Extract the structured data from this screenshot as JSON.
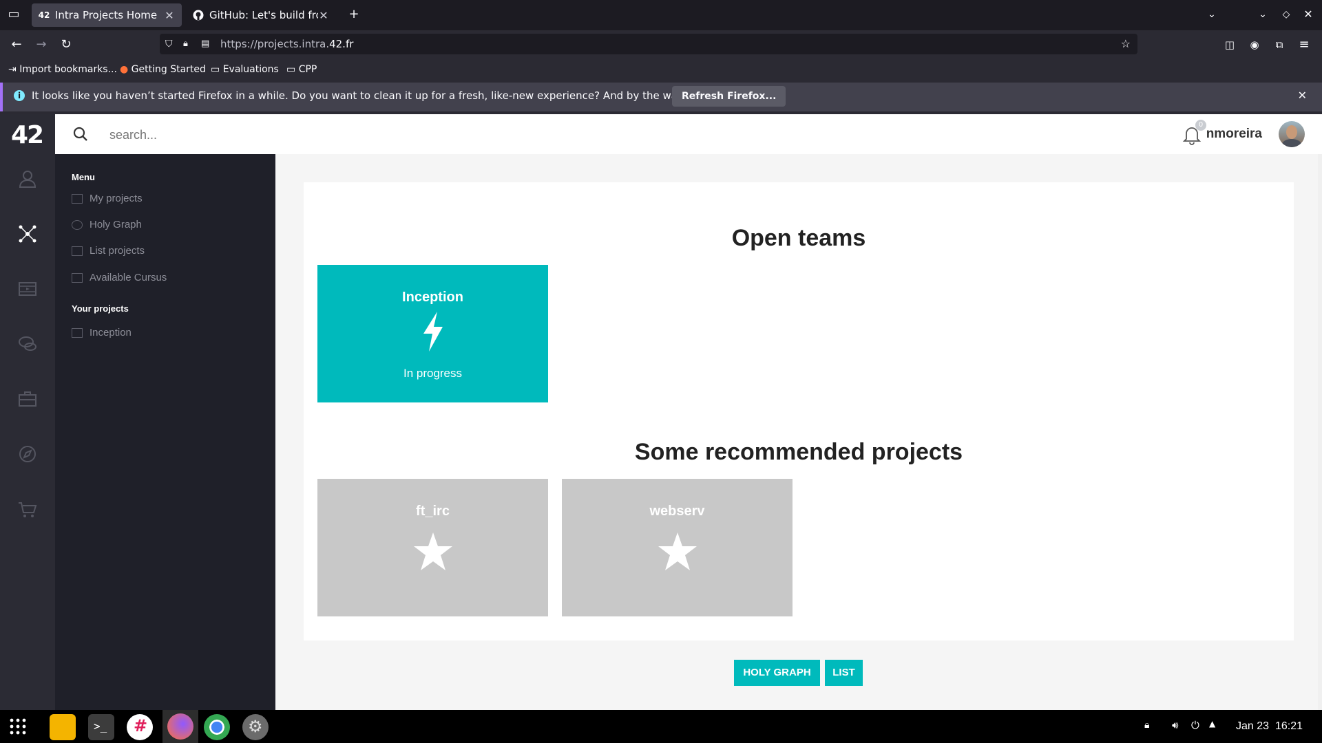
{
  "browser": {
    "tabs": [
      {
        "title": "Intra Projects Home",
        "active": true
      },
      {
        "title": "GitHub: Let's build from h",
        "active": false
      }
    ],
    "url_prefix": "https://projects.intra.",
    "url_domain": "42.fr",
    "bookmarks": [
      "Import bookmarks...",
      "Getting Started",
      "Evaluations",
      "CPP"
    ],
    "notice": "It looks like you haven’t started Firefox in a while. Do you want to clean it up for a fresh, like-new experience? And by the way, welcome back!",
    "notice_button": "Refresh Firefox..."
  },
  "app": {
    "logo": "42",
    "search_placeholder": "search...",
    "notifications_count": "0",
    "username": "nmoreira",
    "menu": {
      "heading": "Menu",
      "items": [
        "My projects",
        "Holy Graph",
        "List projects",
        "Available Cursus"
      ],
      "your_projects_heading": "Your projects",
      "your_projects": [
        "Inception"
      ]
    },
    "open_teams_title": "Open teams",
    "open_teams": [
      {
        "name": "Inception",
        "status": "In progress",
        "icon": "lightning-icon",
        "color": "#00babc"
      }
    ],
    "recommended_title": "Some recommended projects",
    "recommended": [
      {
        "name": "ft_irc",
        "icon": "star-icon",
        "color": "#c8c8c8"
      },
      {
        "name": "webserv",
        "icon": "star-icon",
        "color": "#c8c8c8"
      }
    ],
    "buttons": {
      "holy_graph": "HOLY GRAPH",
      "list": "LIST"
    }
  },
  "system": {
    "date": "Jan 23",
    "time": "16:21"
  }
}
